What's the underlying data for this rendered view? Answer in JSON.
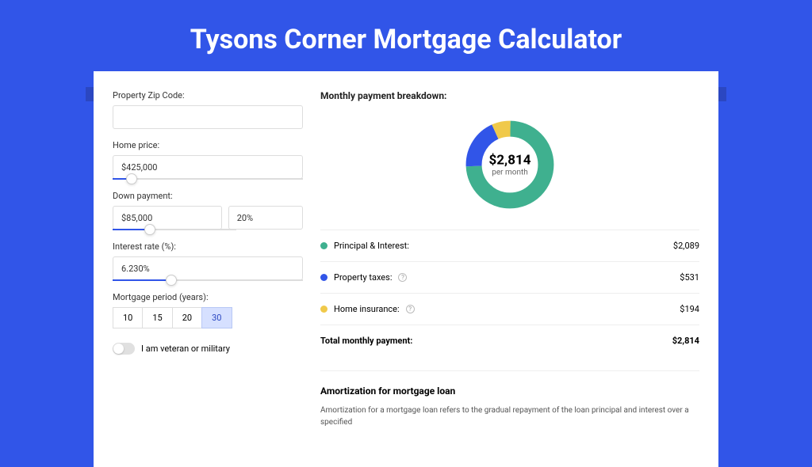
{
  "title": "Tysons Corner Mortgage Calculator",
  "form": {
    "zip_label": "Property Zip Code:",
    "zip_value": "",
    "home_price_label": "Home price:",
    "home_price_value": "$425,000",
    "down_payment_label": "Down payment:",
    "down_payment_amount": "$85,000",
    "down_payment_pct": "20%",
    "interest_label": "Interest rate (%):",
    "interest_value": "6.230%",
    "period_label": "Mortgage period (years):",
    "period_options": [
      "10",
      "15",
      "20",
      "30"
    ],
    "period_selected": "30",
    "veteran_label": "I am veteran or military"
  },
  "breakdown": {
    "title": "Monthly payment breakdown:",
    "center_amount": "$2,814",
    "center_sub": "per month",
    "pi_label": "Principal & Interest:",
    "pi_value": "$2,089",
    "tax_label": "Property taxes:",
    "tax_value": "$531",
    "ins_label": "Home insurance:",
    "ins_value": "$194",
    "total_label": "Total monthly payment:",
    "total_value": "$2,814"
  },
  "amort": {
    "title": "Amortization for mortgage loan",
    "text": "Amortization for a mortgage loan refers to the gradual repayment of the loan principal and interest over a specified"
  },
  "chart_data": {
    "type": "pie",
    "title": "Monthly payment breakdown",
    "series": [
      {
        "name": "Principal & Interest",
        "value": 2089,
        "color": "#3fb08f"
      },
      {
        "name": "Property taxes",
        "value": 531,
        "color": "#3155e8"
      },
      {
        "name": "Home insurance",
        "value": 194,
        "color": "#f0c94a"
      }
    ],
    "total": 2814,
    "unit": "USD per month"
  }
}
